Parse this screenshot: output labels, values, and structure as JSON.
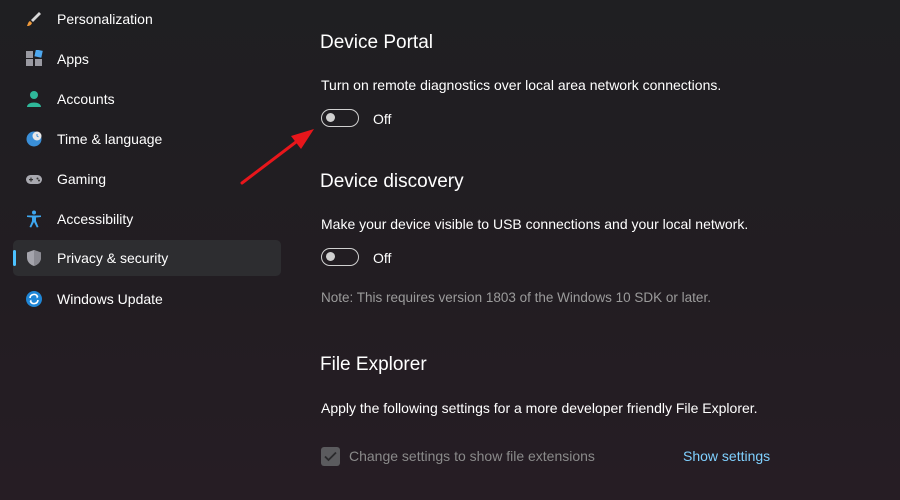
{
  "sidebar": {
    "items": [
      {
        "label": "Personalization",
        "icon": "paintbrush-icon"
      },
      {
        "label": "Apps",
        "icon": "apps-icon"
      },
      {
        "label": "Accounts",
        "icon": "person-icon"
      },
      {
        "label": "Time & language",
        "icon": "globe-clock-icon"
      },
      {
        "label": "Gaming",
        "icon": "gamepad-icon"
      },
      {
        "label": "Accessibility",
        "icon": "accessibility-icon"
      },
      {
        "label": "Privacy & security",
        "icon": "shield-icon",
        "selected": true
      },
      {
        "label": "Windows Update",
        "icon": "update-icon"
      }
    ]
  },
  "main": {
    "device_portal": {
      "title": "Device Portal",
      "description": "Turn on remote diagnostics over local area network connections.",
      "toggle_state": "Off"
    },
    "device_discovery": {
      "title": "Device discovery",
      "description": "Make your device visible to USB connections and your local network.",
      "toggle_state": "Off",
      "note": "Note: This requires version 1803 of the Windows 10 SDK or later."
    },
    "file_explorer": {
      "title": "File Explorer",
      "description": "Apply the following settings for a more developer friendly File Explorer.",
      "checkbox_label": "Change settings to show file extensions",
      "checkbox_checked": true,
      "link_label": "Show settings"
    }
  },
  "colors": {
    "accent": "#4cc2ff",
    "link": "#7fd0ff",
    "annotation_arrow": "#e8161b"
  }
}
